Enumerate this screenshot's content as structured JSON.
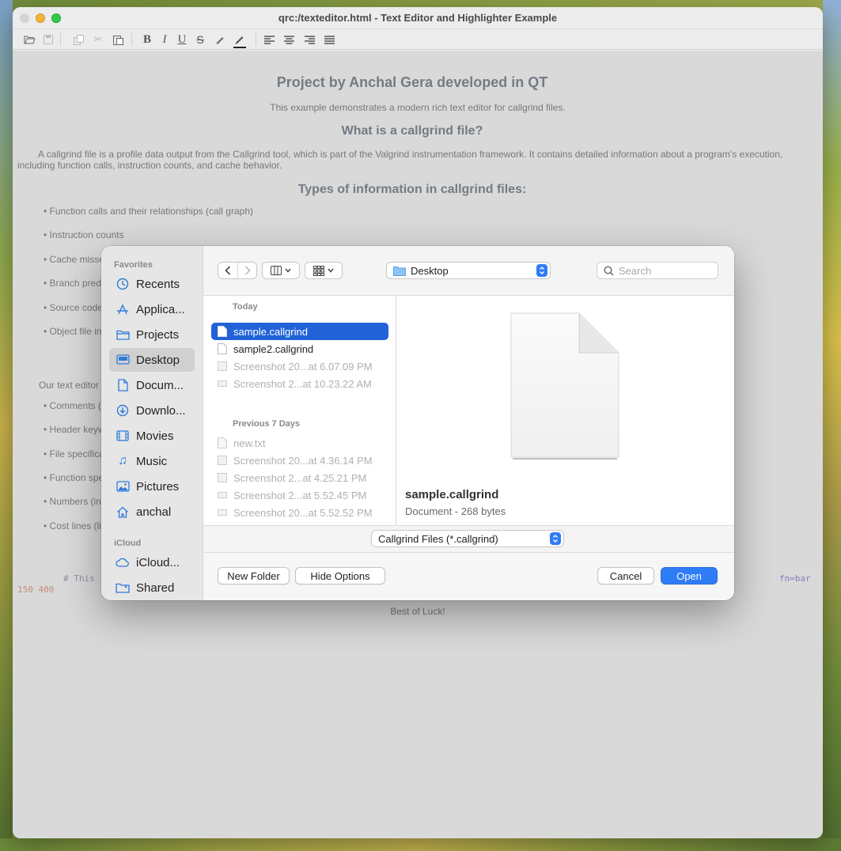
{
  "window": {
    "title": "qrc:/texteditor.html - Text Editor and Highlighter Example"
  },
  "toolbar": {
    "items": [
      "open-icon",
      "save-icon",
      "copy-icon",
      "cut-icon",
      "paste-icon",
      "bold",
      "italic",
      "underline",
      "strikethrough",
      "highlight-pen-icon",
      "text-color-icon",
      "align-left-icon",
      "align-center-icon",
      "align-right-icon",
      "justify-icon"
    ],
    "bold_label": "B",
    "italic_label": "I",
    "underline_label": "U",
    "strike_label": "S"
  },
  "document": {
    "title": "Project by Anchal Gera developed in QT",
    "subtitle": "This example demonstrates a modern rich text editor for callgrind files.",
    "heading1": "What is a callgrind file?",
    "paragraph": "A callgrind file is a profile data output from the Callgrind tool, which is part of the Valgrind instrumentation framework. It contains detailed information about a program's execution, including function calls, instruction counts, and cache behavior.",
    "heading2": "Types of information in callgrind files:",
    "bullets1": [
      "• Function calls and their relationships (call graph)",
      "• Instruction counts",
      "• Cache misse",
      "• Branch pred",
      "• Source code",
      "• Object file in"
    ],
    "intro2": "Our text editor",
    "bullets2": [
      "• Comments (",
      "• Header keyw",
      "• File specifica",
      "• Function spe",
      "• Numbers (in",
      "• Cost lines (li"
    ],
    "code_comment": "# This",
    "code_numbers": "150 400",
    "code_fn": "fn=bar",
    "closing": "Best of Luck!"
  },
  "dialog": {
    "sidebar": {
      "favorites_label": "Favorites",
      "favorites": [
        {
          "label": "Recents",
          "icon": "clock-icon"
        },
        {
          "label": "Applica...",
          "icon": "applications-icon"
        },
        {
          "label": "Projects",
          "icon": "folder-icon"
        },
        {
          "label": "Desktop",
          "icon": "desktop-icon",
          "selected": true
        },
        {
          "label": "Docum...",
          "icon": "document-icon"
        },
        {
          "label": "Downlo...",
          "icon": "download-icon"
        },
        {
          "label": "Movies",
          "icon": "film-icon"
        },
        {
          "label": "Music",
          "icon": "music-note-icon"
        },
        {
          "label": "Pictures",
          "icon": "photo-icon"
        },
        {
          "label": "anchal",
          "icon": "home-icon"
        }
      ],
      "icloud_label": "iCloud",
      "icloud": [
        {
          "label": "iCloud...",
          "icon": "cloud-icon"
        },
        {
          "label": "Shared",
          "icon": "shared-folder-icon"
        }
      ]
    },
    "location": "Desktop",
    "search_placeholder": "Search",
    "files": {
      "today_label": "Today",
      "today": [
        {
          "name": "sample.callgrind",
          "selected": true
        },
        {
          "name": "sample2.callgrind"
        },
        {
          "name": "Screenshot 20...at 6.07.09 PM",
          "dimmed": true
        },
        {
          "name": "Screenshot 2...at 10.23.22 AM",
          "dimmed": true
        }
      ],
      "prev_label": "Previous 7 Days",
      "previous": [
        {
          "name": "new.txt",
          "dimmed": true
        },
        {
          "name": "Screenshot 20...at 4.36.14 PM",
          "dimmed": true
        },
        {
          "name": "Screenshot 2...at 4.25.21 PM",
          "dimmed": true
        },
        {
          "name": "Screenshot 2...at 5.52.45 PM",
          "dimmed": true
        },
        {
          "name": "Screenshot 20...at 5.52.52 PM",
          "dimmed": true
        }
      ]
    },
    "preview": {
      "name": "sample.callgrind",
      "meta": "Document - 268 bytes"
    },
    "filter": "Callgrind Files (*.callgrind)",
    "buttons": {
      "new_folder": "New Folder",
      "hide_options": "Hide Options",
      "cancel": "Cancel",
      "open": "Open"
    }
  },
  "colors": {
    "accent": "#2e7cf6",
    "selection": "#2162d8",
    "sidebar_icon": "#2f7bd9",
    "code_comment": "#a0a0c0",
    "code_numbers": "#e09a80",
    "code_fn": "#8a8ad8"
  }
}
